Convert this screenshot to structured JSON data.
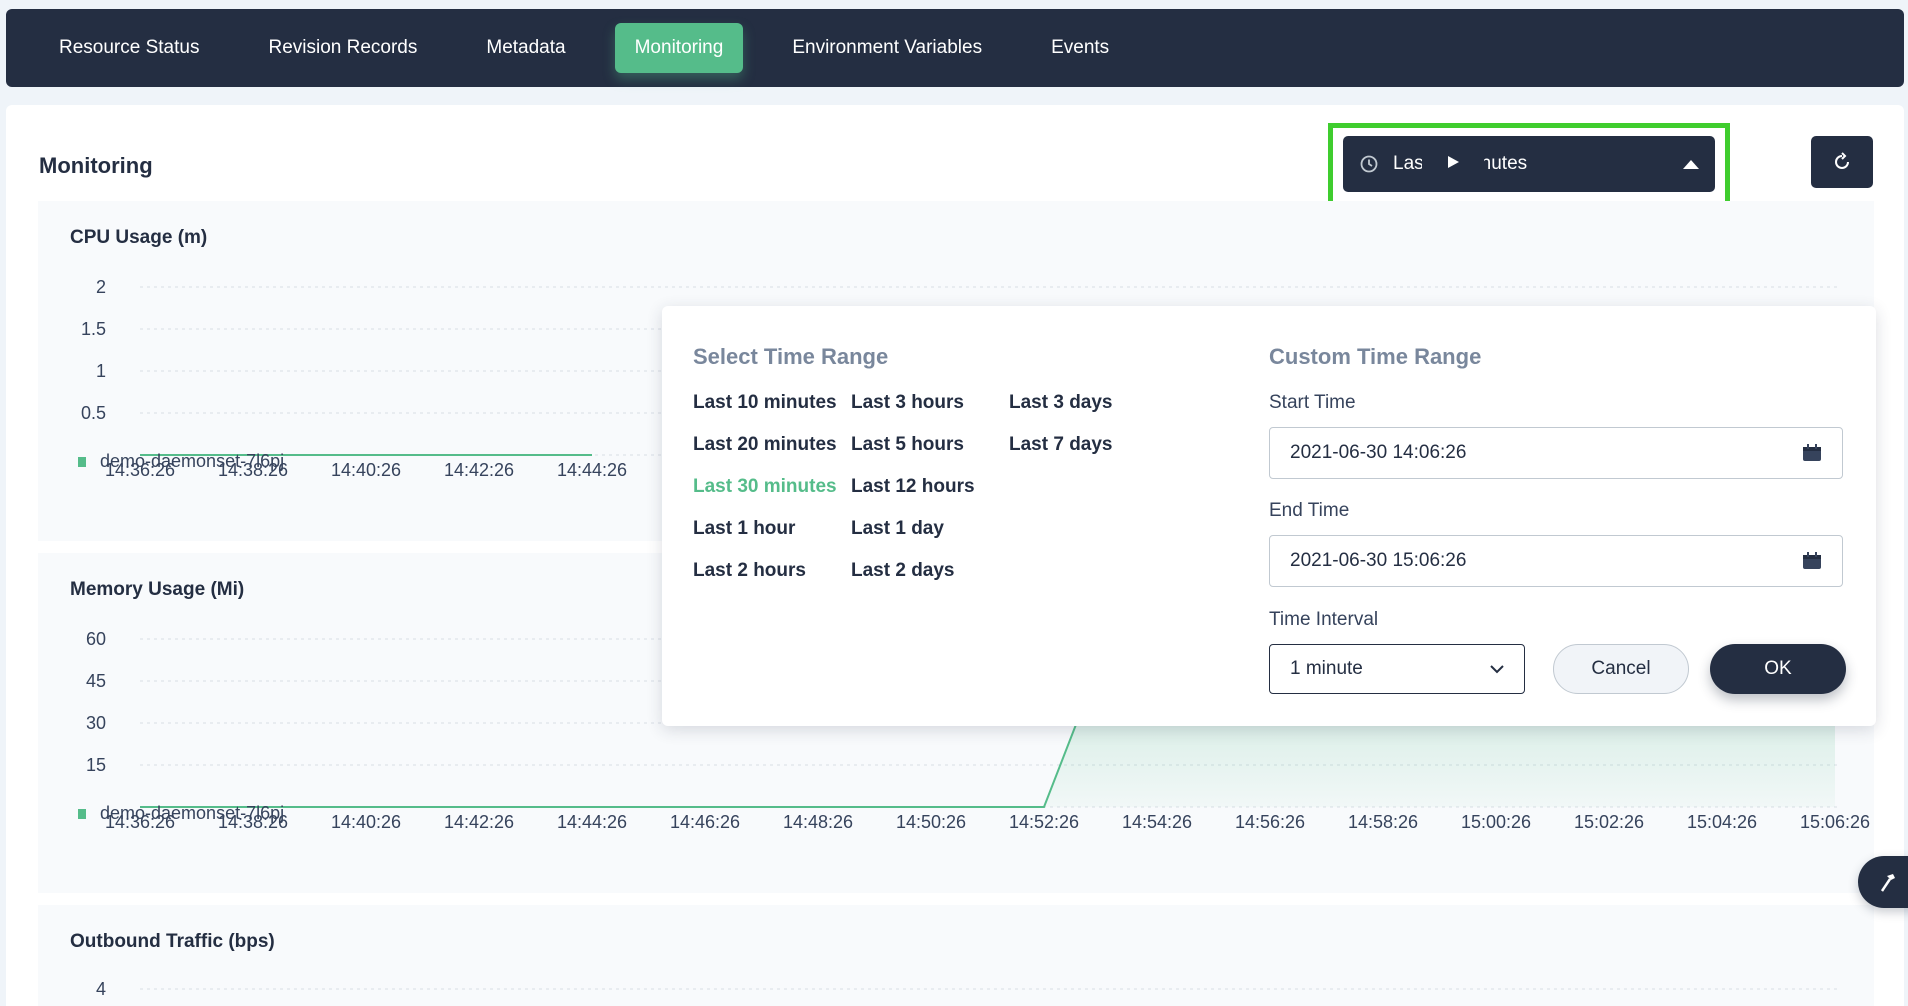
{
  "tabs": [
    {
      "label": "Resource Status"
    },
    {
      "label": "Revision Records"
    },
    {
      "label": "Metadata"
    },
    {
      "label": "Monitoring",
      "active": true
    },
    {
      "label": "Environment Variables"
    },
    {
      "label": "Events"
    }
  ],
  "panel": {
    "title": "Monitoring",
    "time_range_label": "Last 30 minutes",
    "play_icon": "play-icon",
    "refresh_icon": "refresh-icon"
  },
  "popover": {
    "select_heading": "Select Time Range",
    "ranges": [
      [
        "Last 10 minutes",
        "Last 20 minutes",
        "Last 30 minutes",
        "Last 1 hour",
        "Last 2 hours"
      ],
      [
        "Last 3 hours",
        "Last 5 hours",
        "Last 12 hours",
        "Last 1 day",
        "Last 2 days"
      ],
      [
        "Last 3 days",
        "Last 7 days"
      ]
    ],
    "active_range": "Last 30 minutes",
    "custom_heading": "Custom Time Range",
    "start_label": "Start Time",
    "start_value": "2021-06-30 14:06:26",
    "end_label": "End Time",
    "end_value": "2021-06-30 15:06:26",
    "interval_label": "Time Interval",
    "interval_value": "1 minute",
    "cancel_label": "Cancel",
    "ok_label": "OK"
  },
  "colors": {
    "accent": "#55bc8a",
    "dark": "#242e42",
    "highlight": "#3fcd2e"
  },
  "chart_data": [
    {
      "type": "line",
      "title": "CPU Usage (m)",
      "x": [
        "14:36:26",
        "14:38:26",
        "14:40:26",
        "14:42:26",
        "14:44:26"
      ],
      "yticks": [
        "2",
        "1.5",
        "1",
        "0.5"
      ],
      "ylim": [
        0,
        2
      ],
      "series": [
        {
          "name": "demo-daemonset-7l6pj",
          "values": [
            0,
            0,
            0,
            0,
            0
          ]
        }
      ],
      "grid": true,
      "legend": "bottom-left"
    },
    {
      "type": "area",
      "title": "Memory Usage (Mi)",
      "x": [
        "14:36:26",
        "14:38:26",
        "14:40:26",
        "14:42:26",
        "14:44:26",
        "14:46:26",
        "14:48:26",
        "14:50:26",
        "14:52:26",
        "14:54:26",
        "14:56:26",
        "14:58:26",
        "15:00:26",
        "15:02:26",
        "15:04:26",
        "15:06:26"
      ],
      "yticks": [
        "60",
        "45",
        "30",
        "15"
      ],
      "ylim": [
        0,
        60
      ],
      "series": [
        {
          "name": "demo-daemonset-7l6pj",
          "points": [
            [
              0,
              0
            ],
            [
              16,
              0
            ],
            [
              17,
              52
            ],
            [
              30,
              54
            ]
          ]
        }
      ],
      "grid": true,
      "legend": "bottom-left"
    },
    {
      "type": "line",
      "title": "Outbound Traffic (bps)",
      "yticks": [
        "4"
      ],
      "grid": true
    }
  ]
}
